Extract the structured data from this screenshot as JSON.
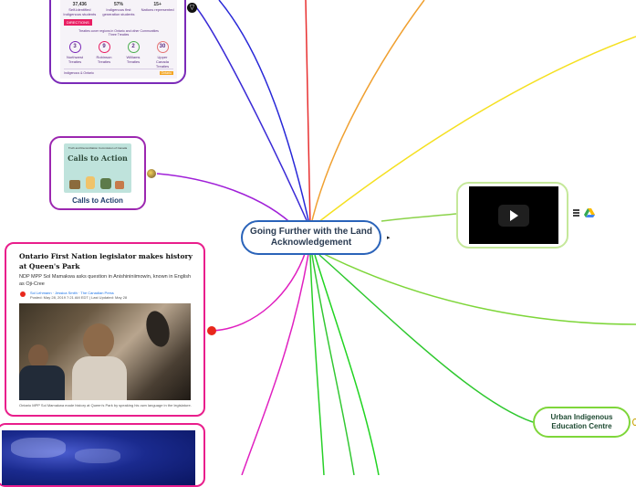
{
  "central_topic": {
    "title": "Going Further with the Land Acknowledgement",
    "collapse_indicator": "▸"
  },
  "infographic_card": {
    "stats": [
      {
        "number": "37,436",
        "caption": "Self-identified Indigenous students"
      },
      {
        "number": "57%",
        "caption": "Indigenous first generation students"
      },
      {
        "number": "15+",
        "caption": "Nations represented"
      }
    ],
    "banner": "DIRECTIONS",
    "subtitle": "Treaties cover regions in Ontario and other Communities",
    "treaty_subtitle": "Three Treaties",
    "treaties": [
      {
        "number": "3",
        "label": "Northwest Treaties"
      },
      {
        "number": "9",
        "label": "Robinson Treaties"
      },
      {
        "number": "2",
        "label": "Williams Treaties"
      },
      {
        "number": "30",
        "label": "Upper Canada Treaties"
      }
    ],
    "footer_left": "Indigenous & Ontario",
    "footer_right": "Ontario"
  },
  "calls_card": {
    "image_text_small": "Truth and Reconciliation Commission of Canada",
    "image_title": "Calls to Action",
    "label": "Calls to Action"
  },
  "news_card": {
    "headline": "Ontario First Nation legislator makes history at Queen's Park",
    "summary": "NDP MPP Sol Mamakwa asks question in Anishininiimowin, known in English as Oji-Cree",
    "byline": "Sol Lehmann · Jessica Smith · The Canadian Press",
    "posted": "Posted: May 28, 2019 7:21 AM EDT | Last Updated: May 28",
    "caption": "Ontario MPP Sol Mamakwa made history at Queen's Park by speaking his own language in the legislature."
  },
  "video_node": {
    "attachment_icons": [
      "list-icon",
      "drive-icon"
    ]
  },
  "urban_node": {
    "label": "Urban Indigenous Education Centre"
  },
  "colors": {
    "blue": "#2a63b9",
    "purple": "#9c27b0",
    "magenta": "#e91e8c",
    "orange": "#f0a030",
    "yellow": "#f5e020",
    "green": "#7ed63a",
    "bright_green": "#22cc22"
  }
}
